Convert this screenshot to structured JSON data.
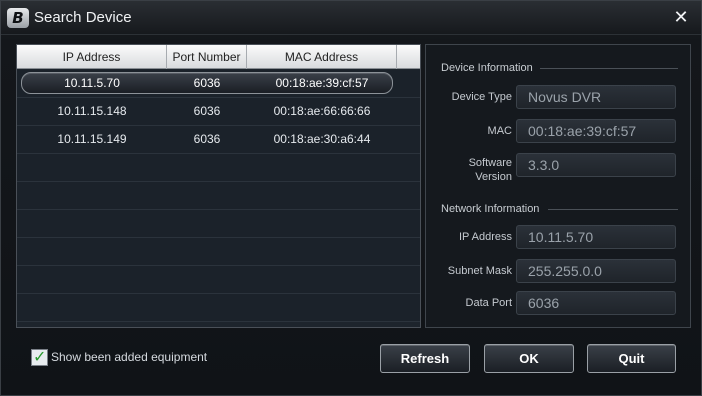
{
  "window": {
    "title": "Search Device",
    "logo_text": "B",
    "close_label": "✕"
  },
  "list": {
    "columns": [
      "IP Address",
      "Port Number",
      "MAC Address"
    ],
    "rows": [
      {
        "ip": "10.11.5.70",
        "port": "6036",
        "mac": "00:18:ae:39:cf:57",
        "selected": true
      },
      {
        "ip": "10.11.15.148",
        "port": "6036",
        "mac": "00:18:ae:66:66:66",
        "selected": false
      },
      {
        "ip": "10.11.15.149",
        "port": "6036",
        "mac": "00:18:ae:30:a6:44",
        "selected": false
      }
    ],
    "empty_row_count": 6
  },
  "device_info": {
    "section_title": "Device Information",
    "device_type_label": "Device Type",
    "device_type_value": "Novus DVR",
    "mac_label": "MAC",
    "mac_value": "00:18:ae:39:cf:57",
    "software_version_label_1": "Software",
    "software_version_label_2": "Version",
    "software_version_value": "3.3.0"
  },
  "network_info": {
    "section_title": "Network Information",
    "ip_label": "IP Address",
    "ip_value": "10.11.5.70",
    "subnet_label": "Subnet Mask",
    "subnet_value": "255.255.0.0",
    "port_label": "Data Port",
    "port_value": "6036"
  },
  "footer": {
    "checkbox_label": "Show been added equipment",
    "checkbox_checked": true,
    "refresh_label": "Refresh",
    "ok_label": "OK",
    "quit_label": "Quit"
  },
  "colors": {
    "background": "#101317",
    "selected_row_border": "#8c9298",
    "checkbox_check": "#2a9a2f"
  }
}
